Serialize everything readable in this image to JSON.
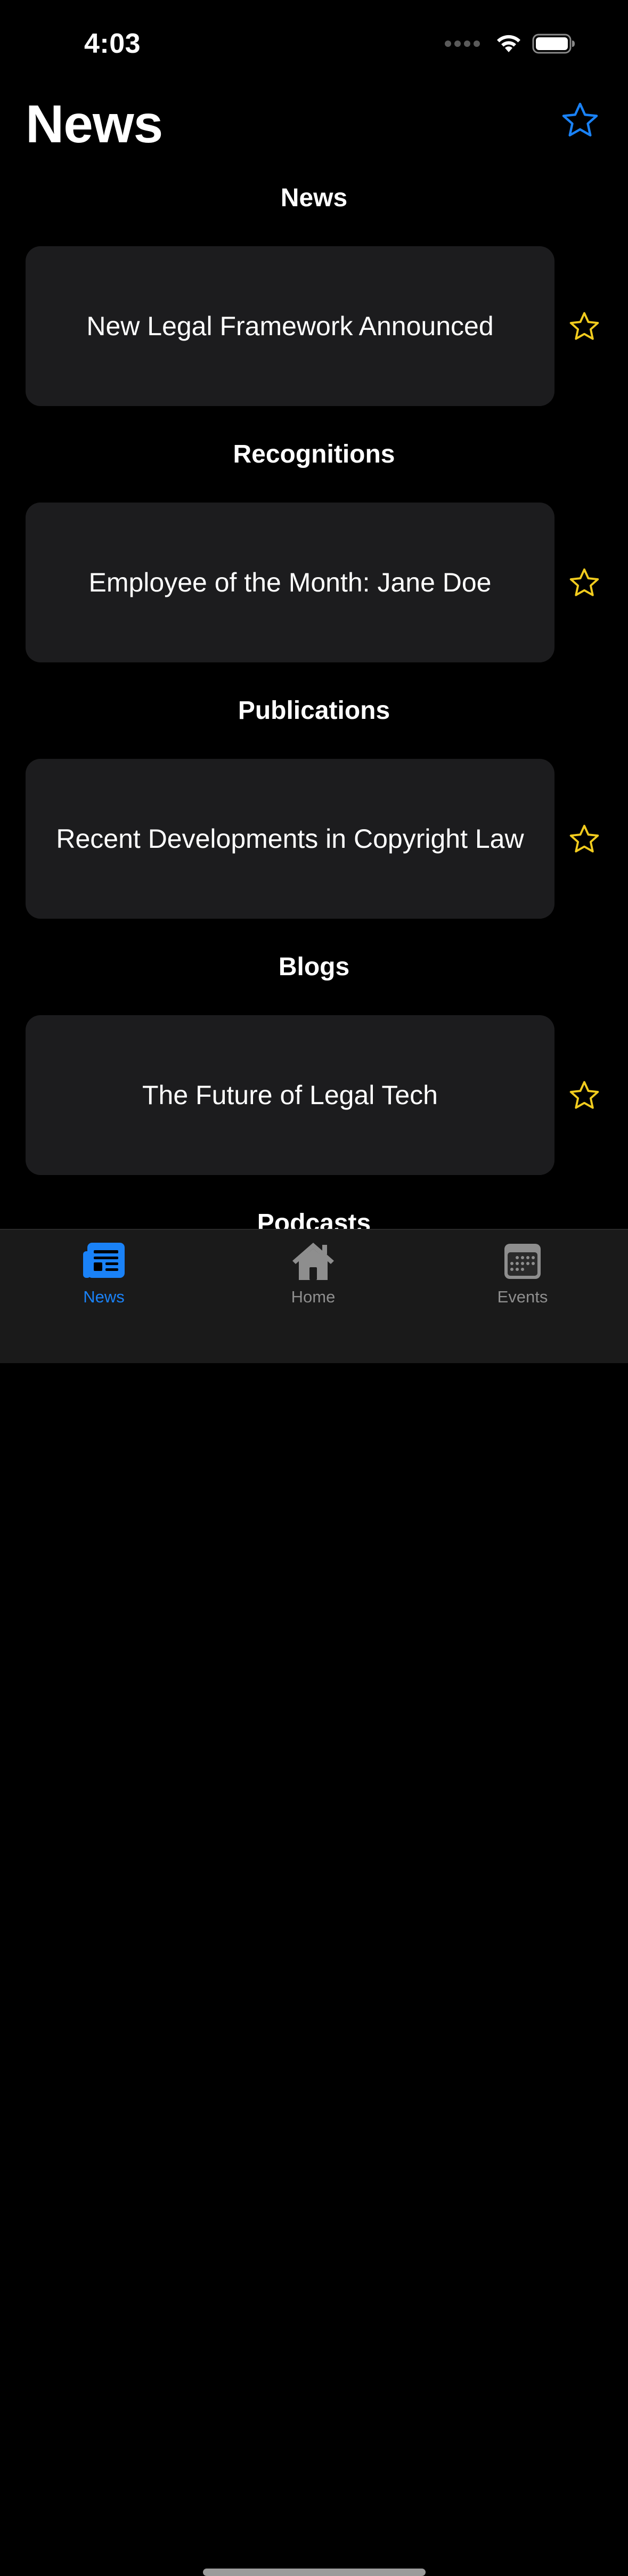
{
  "status_bar": {
    "time": "4:03"
  },
  "header": {
    "title": "News",
    "favorites_icon": "star-outline-icon"
  },
  "sections": [
    {
      "title": "News",
      "card_title": "New Legal Framework Announced"
    },
    {
      "title": "Recognitions",
      "card_title": "Employee of the Month: Jane Doe"
    },
    {
      "title": "Publications",
      "card_title": "Recent Developments in Copyright Law"
    },
    {
      "title": "Blogs",
      "card_title": "The Future of Legal Tech"
    },
    {
      "title": "Podcasts"
    }
  ],
  "tab_bar": {
    "tabs": [
      {
        "label": "News",
        "icon": "newspaper-icon",
        "active": true
      },
      {
        "label": "Home",
        "icon": "house-icon",
        "active": false
      },
      {
        "label": "Events",
        "icon": "calendar-icon",
        "active": false
      }
    ]
  },
  "colors": {
    "background": "#000000",
    "card": "#1c1c1e",
    "accent": "#1a82f7",
    "favorite_star": "#f2cc1e",
    "inactive_tab": "#8e8e8e"
  }
}
